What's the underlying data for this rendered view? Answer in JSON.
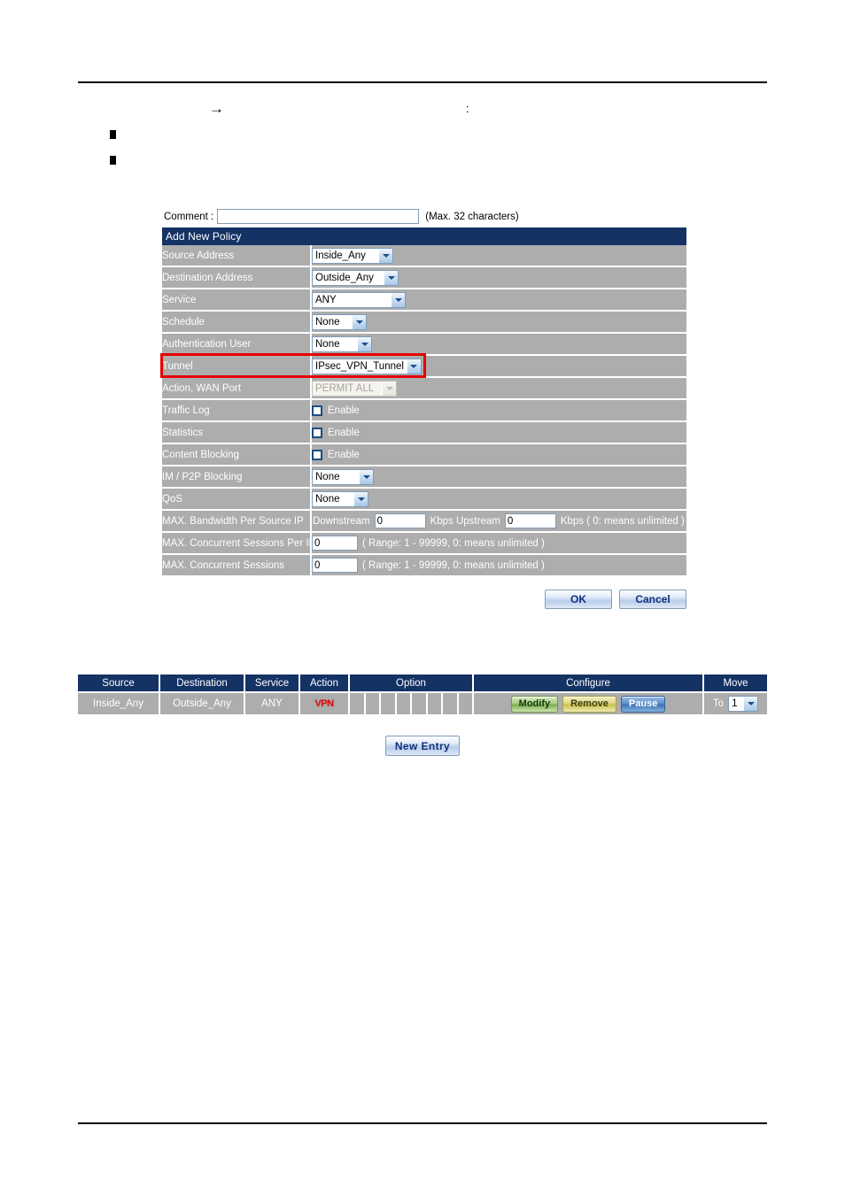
{
  "page": {
    "intro_arrow": "→",
    "intro_colon": ":",
    "intro_text": "",
    "bullet1_text": "",
    "bullet2_text": ""
  },
  "form": {
    "comment_label": "Comment :",
    "comment_value": "",
    "comment_placeholder": "",
    "comment_hint": "(Max. 32 characters)",
    "title": "Add New Policy",
    "rows": [
      {
        "label": "Source Address",
        "value": "Inside_Any",
        "kind": "select"
      },
      {
        "label": "Destination Address",
        "value": "Outside_Any",
        "kind": "select"
      },
      {
        "label": "Service",
        "value": "ANY",
        "kind": "select"
      },
      {
        "label": "Schedule",
        "value": "None",
        "kind": "select"
      },
      {
        "label": "Authentication User",
        "value": "None",
        "kind": "select"
      },
      {
        "label": "Tunnel",
        "value": "IPsec_VPN_Tunnel",
        "kind": "select"
      },
      {
        "label": "Action, WAN Port",
        "value": "PERMIT ALL",
        "kind": "select-disabled"
      },
      {
        "label": "Traffic Log",
        "value": "Enable",
        "kind": "checkbox",
        "checked": false
      },
      {
        "label": "Statistics",
        "value": "Enable",
        "kind": "checkbox",
        "checked": false
      },
      {
        "label": "Content Blocking",
        "value": "Enable",
        "kind": "checkbox",
        "checked": false
      },
      {
        "label": "IM / P2P Blocking",
        "value": "None",
        "kind": "select"
      },
      {
        "label": "QoS",
        "value": "None",
        "kind": "select"
      },
      {
        "label": "MAX. Bandwidth Per Source IP",
        "kind": "bandwidth"
      },
      {
        "label": "MAX. Concurrent Sessions Per IP",
        "value": "0",
        "kind": "number",
        "hint": "( Range: 1 - 99999, 0: means unlimited )"
      },
      {
        "label": "MAX. Concurrent Sessions",
        "value": "0",
        "kind": "number",
        "hint": "( Range: 1 - 99999, 0: means unlimited )"
      }
    ],
    "bandwidth": {
      "downstream_label": "Downstream",
      "downstream_value": "0",
      "kbps_upstream_label": "Kbps Upstream",
      "upstream_value": "0",
      "kbps_tail_label": "Kbps ( 0: means unlimited )"
    },
    "ok_label": "OK",
    "cancel_label": "Cancel"
  },
  "policy_list": {
    "headers": [
      "Source",
      "Destination",
      "Service",
      "Action",
      "Option",
      "Configure",
      "Move"
    ],
    "row": {
      "source": "Inside_Any",
      "destination": "Outside_Any",
      "service": "ANY",
      "action_badge": "VPN",
      "option_cell_count": 8,
      "modify_label": "Modify",
      "remove_label": "Remove",
      "pause_label": "Pause",
      "move_to_label": "To",
      "move_value": "1"
    },
    "new_entry_label": "New Entry"
  },
  "colors": {
    "panel_header": "#143264",
    "row_gray": "#adadad",
    "highlight_red": "#e60000",
    "vpn_red": "#d61616",
    "link_blue": "#10307a"
  }
}
